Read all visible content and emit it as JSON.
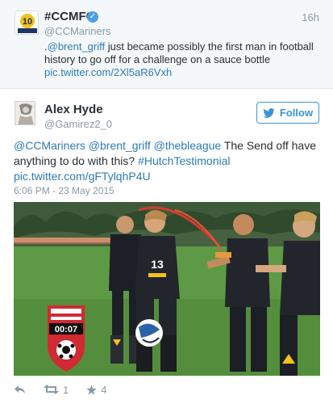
{
  "parent_tweet": {
    "name": "#CCMFC",
    "handle": "@CCMariners",
    "time": "16h",
    "text_prefix": ".",
    "mention": "@brent_griff",
    "text_body": " just became possibly the first man in football history to go off for a challenge on a sauce bottle ",
    "link": "pic.twitter.com/2Xl5aR6Vxh"
  },
  "tweet": {
    "name": "Alex Hyde",
    "handle": "@Gamirez2_0",
    "follow_label": "Follow",
    "mention1": "@CCMariners",
    "mention2": "@brent_griff",
    "mention3": "@thebleague",
    "text_body": " The Send off have anything to do with this? ",
    "hashtag": "#HutchTestimonial",
    "link": "pic.twitter.com/gFTylqhP4U",
    "timestamp": "6:06 PM - 23 May 2015",
    "media": {
      "timer": "00:07",
      "jersey_number": "13"
    },
    "actions": {
      "retweets": "1",
      "favorites": "4"
    }
  },
  "colors": {
    "link": "#2b7bb9",
    "follow": "#3b94d9",
    "muted": "#8899a6",
    "badge_red": "#d12a32"
  }
}
